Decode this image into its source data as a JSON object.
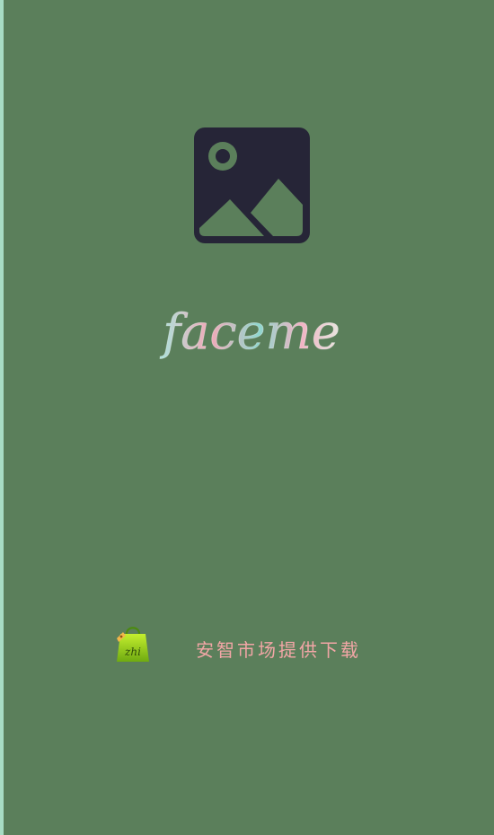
{
  "splash": {
    "app_name": "faceme",
    "download_source_text": "安智市场提供下载",
    "store_logo_text": "zhi"
  },
  "icons": {
    "placeholder": "image-placeholder-icon",
    "store": "anzhi-market-bag-icon"
  },
  "colors": {
    "background": "#5b7f5b",
    "left_edge": "#a8dcc4",
    "icon_dark": "#262537",
    "download_text": "#f2a6a6",
    "title_gradient": [
      "#a9e4dc",
      "#f3a9b8",
      "#8fd7cf",
      "#f0b2c3"
    ],
    "store_bag": "#8fcf1a"
  }
}
